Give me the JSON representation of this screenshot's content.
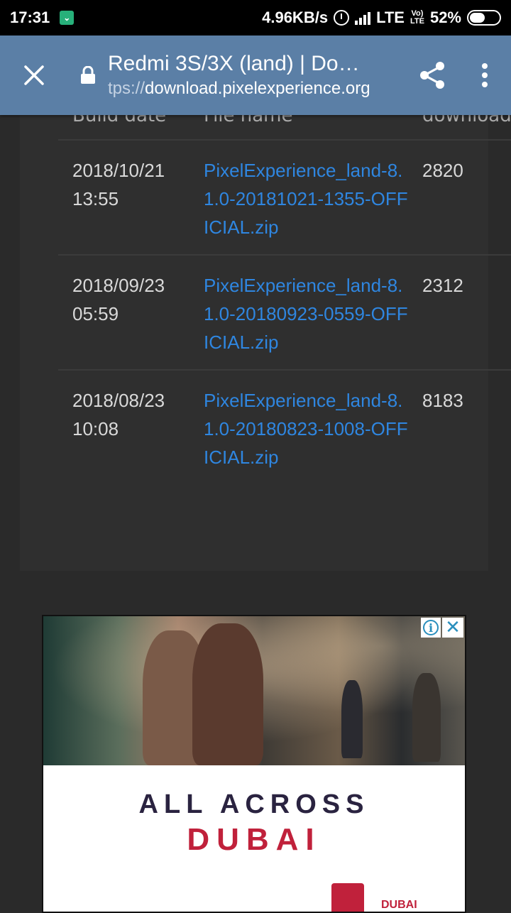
{
  "status_bar": {
    "time": "17:31",
    "net_speed": "4.96KB/s",
    "network": "LTE",
    "volte_top": "Vo)",
    "volte_bottom": "LTE",
    "battery": "52%",
    "battery_level": 0.52
  },
  "toolbar": {
    "title": "Redmi 3S/3X (land) | Do…",
    "url_scheme": "tps://",
    "url_host": "download.pixelexperience.org"
  },
  "table": {
    "headers": [
      "Build date",
      "File name",
      "downloads"
    ],
    "rows": [
      {
        "date": "2018/10/21 13:55",
        "file": "PixelExperience_land-8.1.0-20181021-1355-OFFICIAL.zip",
        "downloads": "2820"
      },
      {
        "date": "2018/09/23 05:59",
        "file": "PixelExperience_land-8.1.0-20180923-0559-OFFICIAL.zip",
        "downloads": "2312"
      },
      {
        "date": "2018/08/23 10:08",
        "file": "PixelExperience_land-8.1.0-20180823-1008-OFFICIAL.zip",
        "downloads": "8183"
      }
    ]
  },
  "ad": {
    "line1": "ALL ACROSS",
    "line2": "DUBAI",
    "brand_text": "DUBAI",
    "info_symbol": "i",
    "close_symbol": "✕"
  },
  "icons": {
    "close": "close-icon",
    "lock": "lock-icon",
    "share": "share-icon",
    "menu": "more-vert-icon"
  },
  "colors": {
    "toolbar": "#5b7fa6",
    "link": "#2f86e0",
    "ad_accent": "#c0213b"
  }
}
